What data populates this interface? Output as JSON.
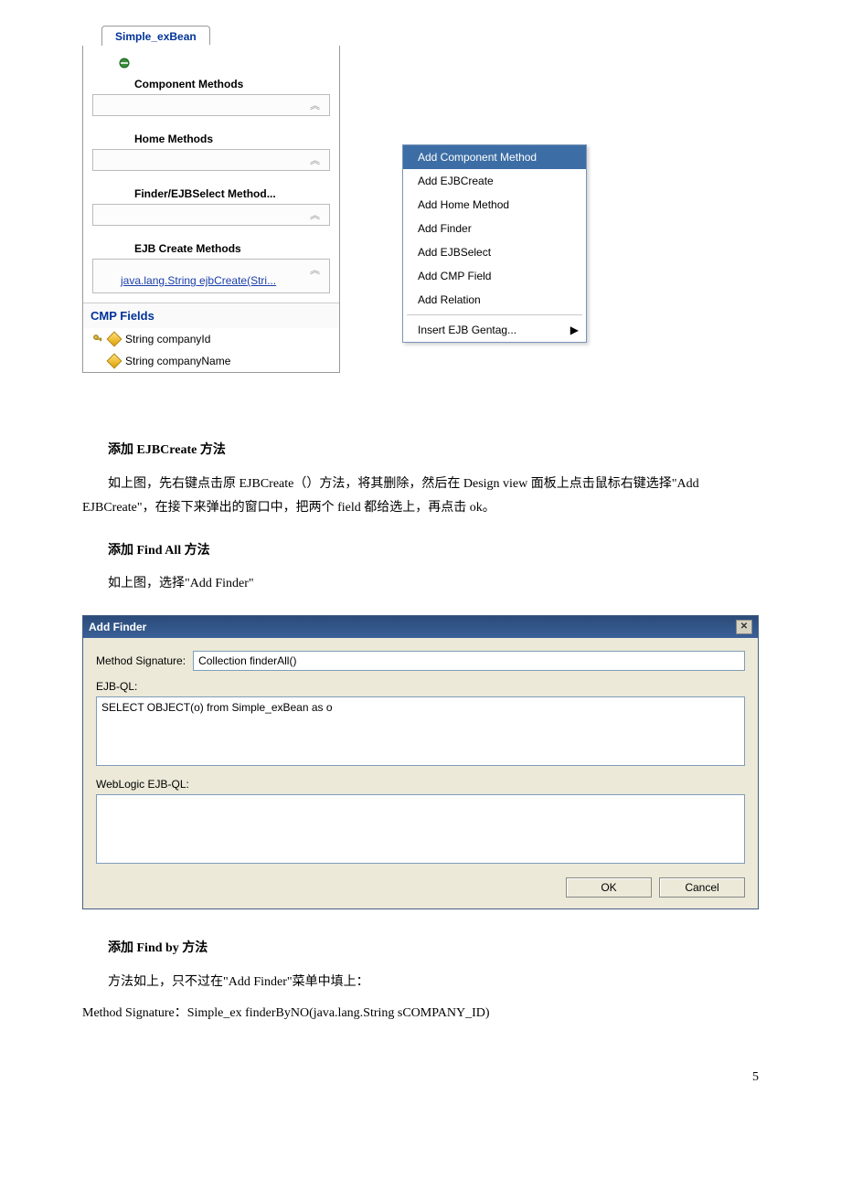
{
  "designView": {
    "tabLabel": "Simple_exBean",
    "sections": {
      "component": "Component Methods",
      "home": "Home Methods",
      "finder": "Finder/EJBSelect Method...",
      "create": "EJB Create Methods",
      "createLink": "java.lang.String ejbCreate(Stri..."
    },
    "cmpHeader": "CMP Fields",
    "cmpFields": [
      {
        "label": "String companyId",
        "key": true
      },
      {
        "label": "String companyName",
        "key": false
      }
    ]
  },
  "contextMenu": {
    "items": [
      "Add Component Method",
      "Add EJBCreate",
      "Add Home Method",
      "Add Finder",
      "Add EJBSelect",
      "Add CMP Field",
      "Add Relation"
    ],
    "submenu": "Insert EJB Gentag..."
  },
  "article": {
    "h1": "添加 EJBCreate 方法",
    "p1": "如上图，先右键点击原 EJBCreate（）方法，将其删除，然后在 Design view 面板上点击鼠标右键选择\"Add EJBCreate\"，在接下来弹出的窗口中，把两个 field 都给选上，再点击 ok。",
    "h2": "添加 Find All 方法",
    "p2": "如上图，选择\"Add Finder\"",
    "h3": "添加 Find by 方法",
    "p3": "方法如上，只不过在\"Add Finder\"菜单中填上：",
    "p4": "Method Signature：Simple_ex finderByNO(java.lang.String sCOMPANY_ID)"
  },
  "dialog": {
    "title": "Add Finder",
    "methodSigLabel": "Method Signature:",
    "methodSigValue": "Collection finderAll()",
    "ejbqlLabel": "EJB-QL:",
    "ejbqlValue": "SELECT OBJECT(o) from Simple_exBean as o",
    "wlejbqlLabel": "WebLogic EJB-QL:",
    "wlejbqlValue": "",
    "ok": "OK",
    "cancel": "Cancel"
  },
  "pageNumber": "5"
}
